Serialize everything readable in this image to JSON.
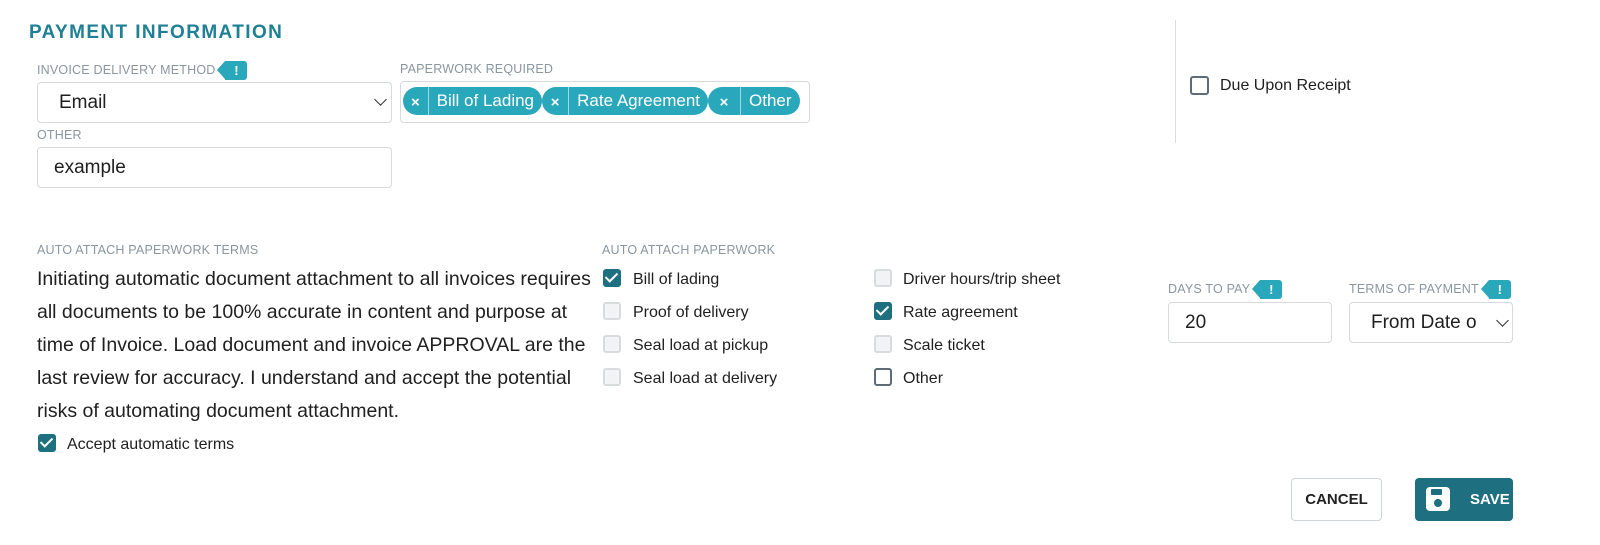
{
  "section": {
    "title": "PAYMENT INFORMATION"
  },
  "invoice_delivery": {
    "label": "INVOICE DELIVERY METHOD",
    "value": "Email",
    "other_label": "OTHER",
    "other_value": "example"
  },
  "paperwork_required": {
    "label": "PAPERWORK REQUIRED",
    "chips": [
      "Bill of Lading",
      "Rate Agreement",
      "Other"
    ],
    "remove_symbol": "×"
  },
  "due_upon_receipt": {
    "label": "Due Upon Receipt",
    "checked": false
  },
  "auto_terms": {
    "label": "AUTO ATTACH PAPERWORK TERMS",
    "text": "Initiating automatic document attachment to all invoices requires all documents to be 100% accurate in content and purpose at time of Invoice. Load document and invoice APPROVAL are the last review for accuracy. I understand and accept the potential risks of automating document attachment.",
    "accept_label": "Accept automatic terms",
    "accept_checked": true
  },
  "auto_paperwork": {
    "label": "AUTO ATTACH PAPERWORK",
    "items": [
      {
        "label": "Bill of lading",
        "checked": true
      },
      {
        "label": "Proof of delivery",
        "checked": false
      },
      {
        "label": "Seal load at pickup",
        "checked": false
      },
      {
        "label": "Seal load at delivery",
        "checked": false
      },
      {
        "label": "Driver hours/trip sheet",
        "checked": false
      },
      {
        "label": "Rate agreement",
        "checked": true
      },
      {
        "label": "Scale ticket",
        "checked": false
      },
      {
        "label": "Other",
        "checked": false
      }
    ]
  },
  "days_to_pay": {
    "label": "DAYS TO PAY",
    "value": "20"
  },
  "terms_of_payment": {
    "label": "TERMS OF PAYMENT",
    "value": "From Date o"
  },
  "info_badge_symbol": "!",
  "buttons": {
    "cancel": "CANCEL",
    "save": "SAVE"
  },
  "colors": {
    "accent": "#2aa8bb",
    "primary": "#1e6f80",
    "title": "#1f7f95"
  }
}
